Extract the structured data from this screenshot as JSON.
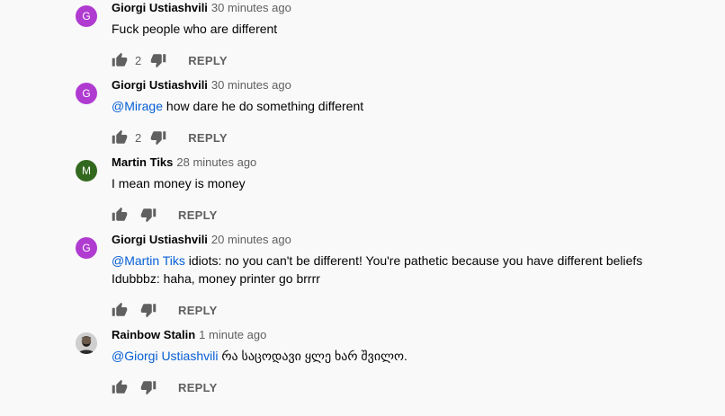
{
  "comments": [
    {
      "author": "Giorgi Ustiashvili",
      "avatar_letter": "G",
      "avatar_color": "#b03bd1",
      "time": "30 minutes ago",
      "mention": "",
      "text": "Fuck people who are different",
      "line2": "",
      "likes": "2",
      "reply_label": "REPLY"
    },
    {
      "author": "Giorgi Ustiashvili",
      "avatar_letter": "G",
      "avatar_color": "#b03bd1",
      "time": "30 minutes ago",
      "mention": "@Mirage",
      "text": " how dare he do something different",
      "line2": "",
      "likes": "2",
      "reply_label": "REPLY"
    },
    {
      "author": "Martin Tiks",
      "avatar_letter": "M",
      "avatar_color": "#33691e",
      "time": "28 minutes ago",
      "mention": "",
      "text": "I mean money is money",
      "line2": "",
      "likes": "",
      "reply_label": "REPLY"
    },
    {
      "author": "Giorgi Ustiashvili",
      "avatar_letter": "G",
      "avatar_color": "#b03bd1",
      "time": "20 minutes ago",
      "mention": "@Martin Tiks",
      "text": " idiots: no you can't be different! You're pathetic because you have different beliefs",
      "line2": "Idubbbz: haha, money printer go brrrr",
      "likes": "",
      "reply_label": "REPLY"
    },
    {
      "author": "Rainbow Stalin",
      "avatar_letter": "",
      "avatar_color": "#d9d9d9",
      "time": "1 minute ago",
      "mention": "@Giorgi Ustiashvili",
      "text": " რა საცოდავი ყლე ხარ შვილო.",
      "line2": "",
      "likes": "",
      "reply_label": "REPLY"
    }
  ],
  "icons": {
    "like": "thumb-up-icon",
    "dislike": "thumb-down-icon"
  },
  "colors": {
    "mention": "#065fd4",
    "secondary_text": "#606060",
    "background": "#f9f9f9"
  }
}
